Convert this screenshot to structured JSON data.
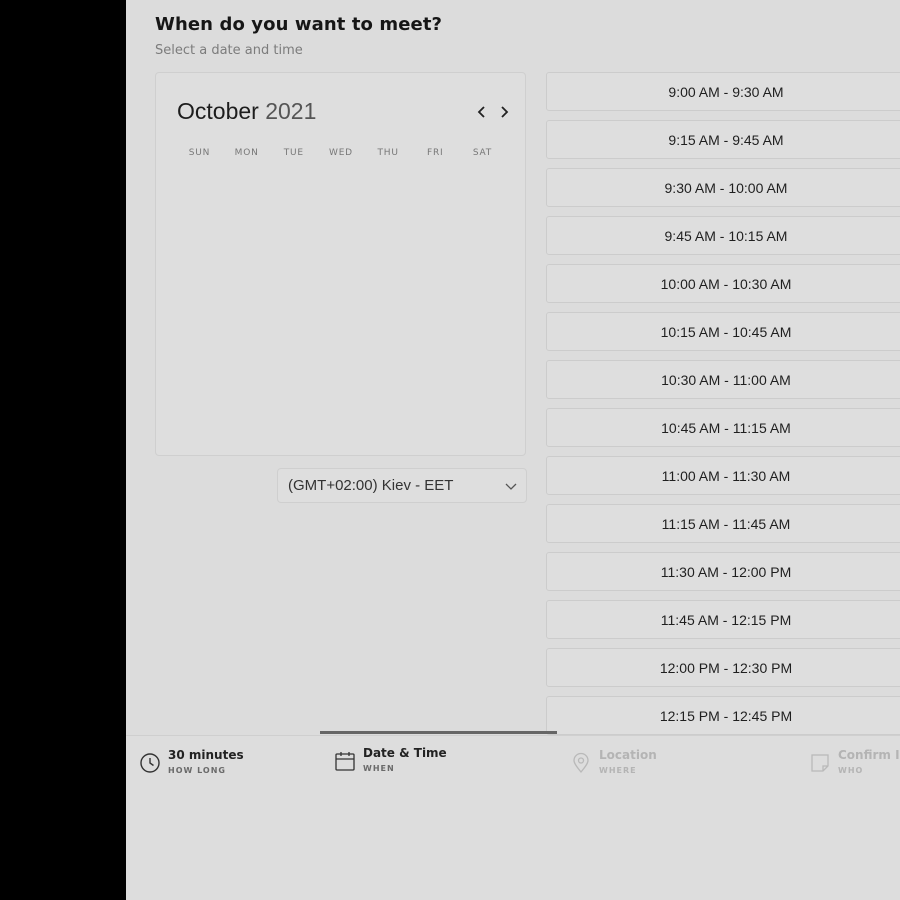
{
  "header": {
    "title": "When do you want to meet?",
    "subtitle": "Select a date and time"
  },
  "calendar": {
    "month": "October",
    "year": "2021",
    "weekdays": [
      "SUN",
      "MON",
      "TUE",
      "WED",
      "THU",
      "FRI",
      "SAT"
    ],
    "prev_icon": "chevron-left-icon",
    "next_icon": "chevron-right-icon"
  },
  "timezone": {
    "selected": "(GMT+02:00) Kiev - EET",
    "icon": "chevron-down-icon"
  },
  "slots": [
    "9:00 AM - 9:30 AM",
    "9:15 AM - 9:45 AM",
    "9:30 AM - 10:00 AM",
    "9:45 AM - 10:15 AM",
    "10:00 AM - 10:30 AM",
    "10:15 AM - 10:45 AM",
    "10:30 AM - 11:00 AM",
    "10:45 AM - 11:15 AM",
    "11:00 AM - 11:30 AM",
    "11:15 AM - 11:45 AM",
    "11:30 AM - 12:00 PM",
    "11:45 AM - 12:15 PM",
    "12:00 PM - 12:30 PM",
    "12:15 PM - 12:45 PM"
  ],
  "steps": [
    {
      "label": "30 minutes",
      "sub": "HOW LONG",
      "icon": "clock-icon",
      "state": "done"
    },
    {
      "label": "Date & Time",
      "sub": "WHEN",
      "icon": "calendar-icon",
      "state": "active"
    },
    {
      "label": "Location",
      "sub": "WHERE",
      "icon": "location-pin-icon",
      "state": "disabled"
    },
    {
      "label": "Confirm Info",
      "sub": "WHO",
      "icon": "note-icon",
      "state": "disabled"
    }
  ],
  "colors": {
    "panel_bg": "#dcdcdc",
    "outer_bg": "#000000",
    "active_step_indicator": "#666666"
  }
}
